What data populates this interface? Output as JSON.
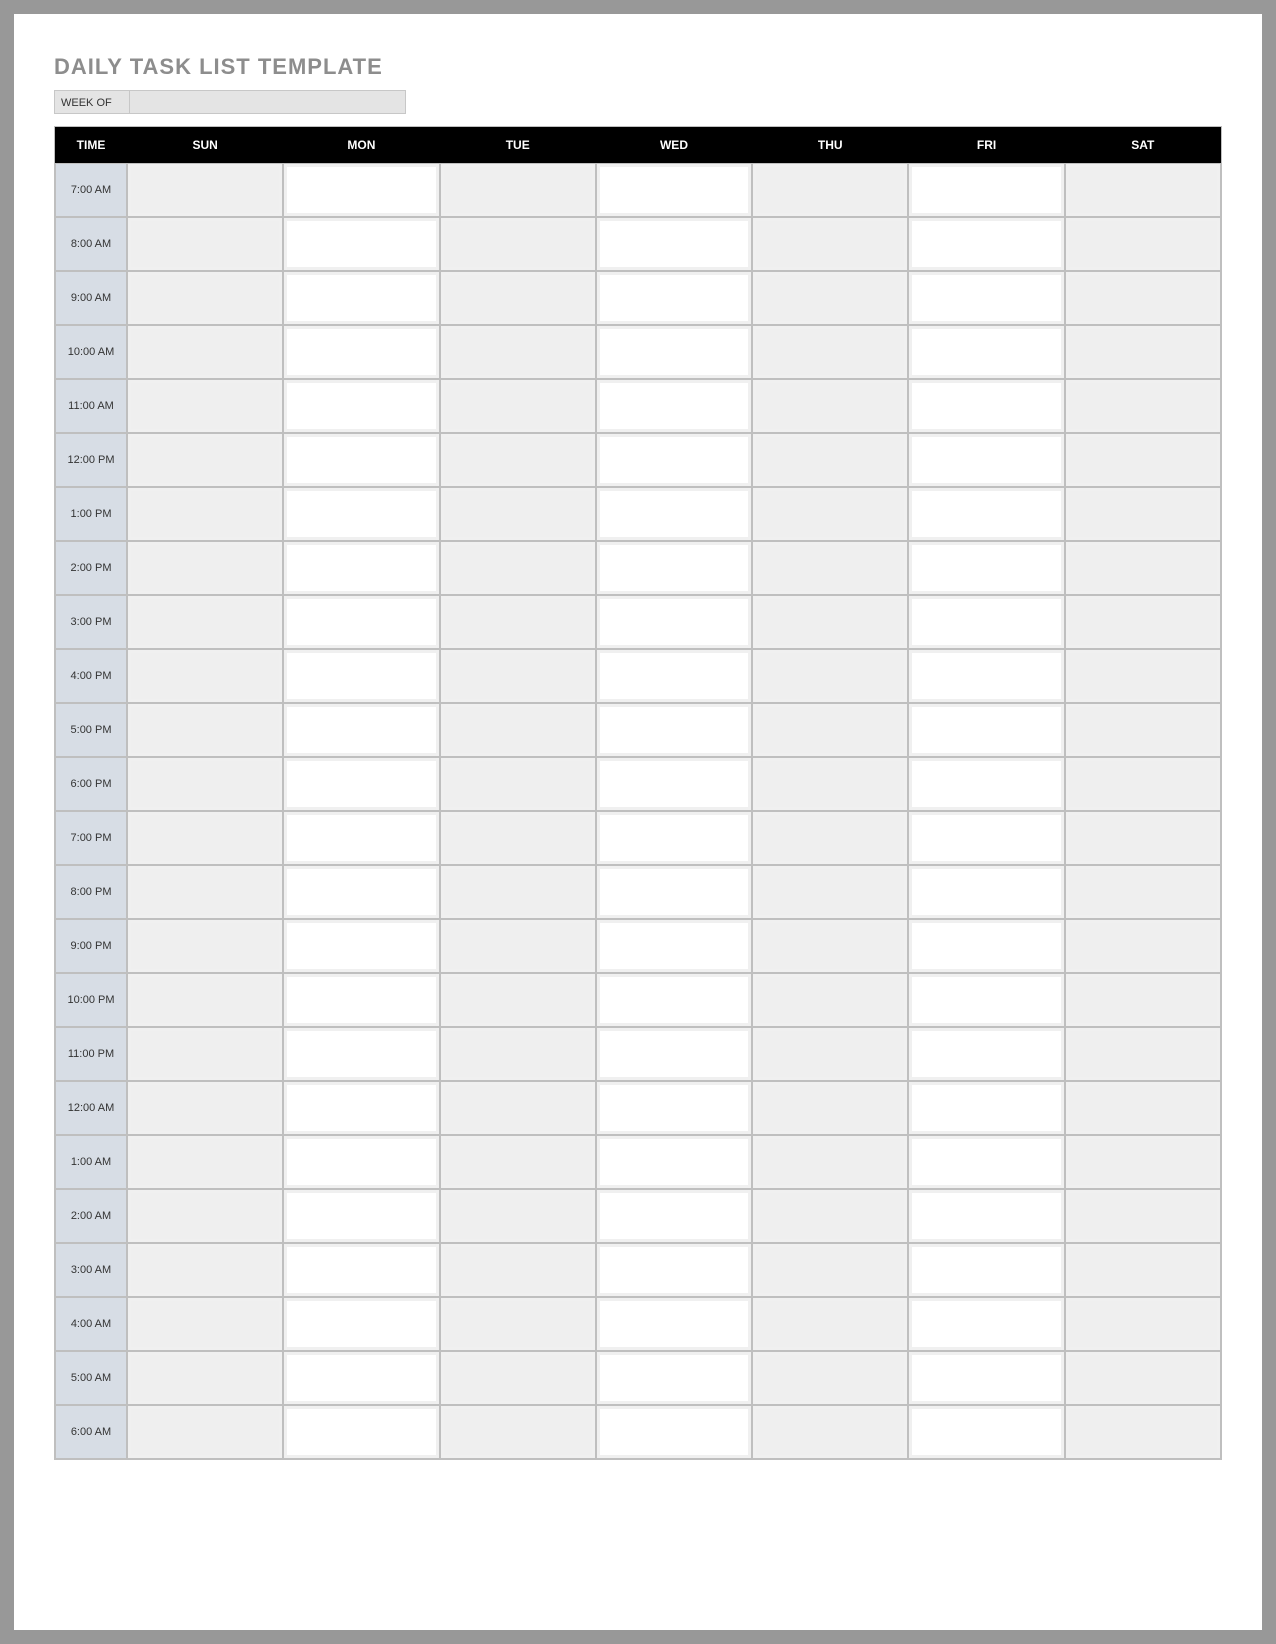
{
  "title": "DAILY TASK LIST TEMPLATE",
  "week_of_label": "WEEK OF",
  "week_of_value": "",
  "headers": [
    "TIME",
    "SUN",
    "MON",
    "TUE",
    "WED",
    "THU",
    "FRI",
    "SAT"
  ],
  "times": [
    "7:00 AM",
    "8:00 AM",
    "9:00 AM",
    "10:00 AM",
    "11:00 AM",
    "12:00 PM",
    "1:00 PM",
    "2:00 PM",
    "3:00 PM",
    "4:00 PM",
    "5:00 PM",
    "6:00 PM",
    "7:00 PM",
    "8:00 PM",
    "9:00 PM",
    "10:00 PM",
    "11:00 PM",
    "12:00 AM",
    "1:00 AM",
    "2:00 AM",
    "3:00 AM",
    "4:00 AM",
    "5:00 AM",
    "6:00 AM"
  ]
}
